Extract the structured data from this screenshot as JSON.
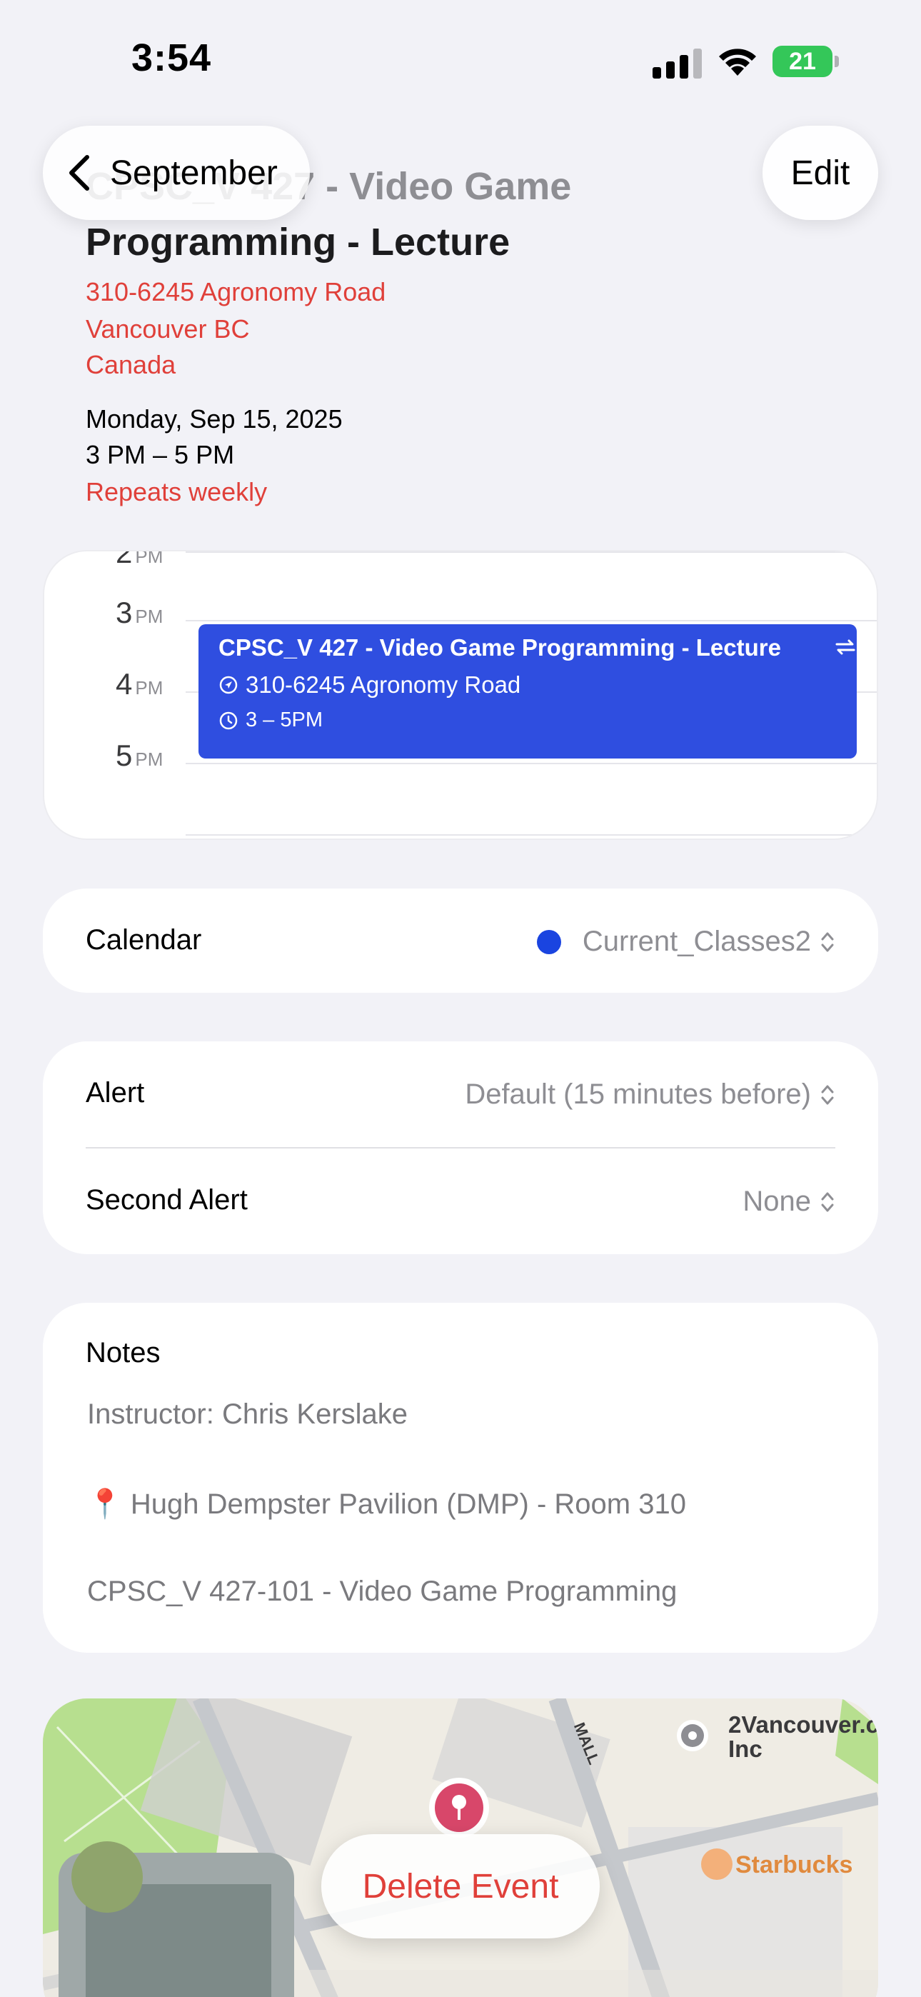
{
  "status_bar": {
    "time": "3:54",
    "battery": "21"
  },
  "nav": {
    "back_label": "September",
    "edit_label": "Edit"
  },
  "event": {
    "title_hidden": "CPSC_V 427 - Video Game",
    "title_part1": "7 - Video Game",
    "title_part2": "Programming - Lecture",
    "address_line1": "310-6245 Agronomy Road",
    "address_line2": "Vancouver BC",
    "address_line3": "Canada",
    "date": "Monday, Sep 15, 2025",
    "time_range": "3 PM – 5 PM",
    "repeat": "Repeats weekly"
  },
  "day_view": {
    "hours": [
      {
        "num": "2",
        "ampm": "PM"
      },
      {
        "num": "3",
        "ampm": "PM"
      },
      {
        "num": "4",
        "ampm": "PM"
      },
      {
        "num": "5",
        "ampm": "PM"
      }
    ],
    "block": {
      "title": "CPSC_V 427 - Video Game Programming - Lecture",
      "location": "310-6245 Agronomy Road",
      "time": "3 – 5PM"
    }
  },
  "calendar_row": {
    "label": "Calendar",
    "value": "Current_Classes2",
    "color": "#1a44e0"
  },
  "alerts": [
    {
      "label": "Alert",
      "value": "Default (15 minutes before)"
    },
    {
      "label": "Second Alert",
      "value": "None"
    }
  ],
  "notes": {
    "title": "Notes",
    "lines": [
      "Instructor: Chris Kerslake",
      "📍 Hugh Dempster Pavilion (DMP) - Room 310",
      "CPSC_V 427-101 - Video Game Programming"
    ]
  },
  "map": {
    "street": "MALL",
    "poi_1": "2Vancouver.c",
    "poi_1_sub": "Inc",
    "poi_2": "Starbucks"
  },
  "delete_label": "Delete Event"
}
